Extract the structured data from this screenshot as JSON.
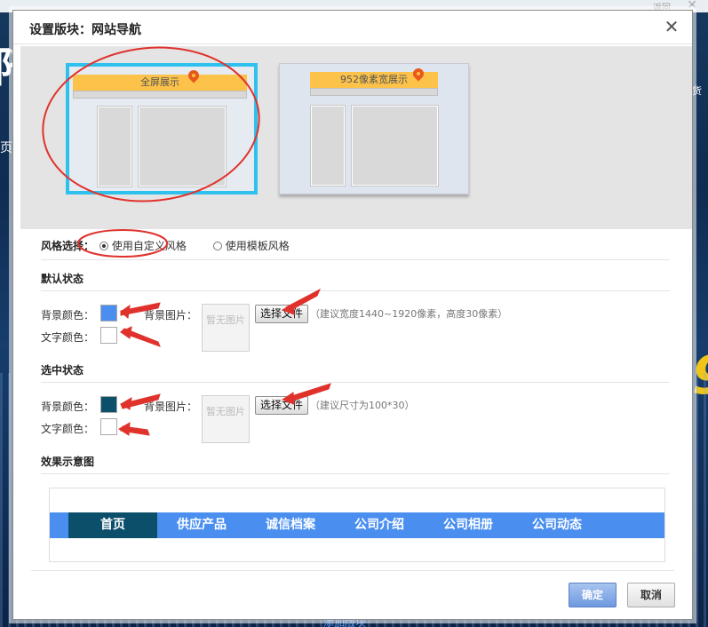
{
  "background": {
    "top_right_text": "返回",
    "big_left_text": "阡",
    "left_label": "页",
    "right_label": "货",
    "right_number": "9",
    "add_block": "添加版块"
  },
  "dialog": {
    "title": "设置版块：网站导航",
    "close_symbol": "✕",
    "layouts": [
      {
        "label": "全屏展示",
        "selected": true
      },
      {
        "label": "952像素宽展示",
        "selected": false
      }
    ],
    "style_select": {
      "label": "风格选择：",
      "options": [
        {
          "label": "使用自定义风格",
          "checked": true
        },
        {
          "label": "使用模板风格",
          "checked": false
        }
      ]
    },
    "default_state": {
      "title": "默认状态",
      "bg_color_label": "背景颜色：",
      "bg_color": "#4a8ff0",
      "text_color_label": "文字颜色：",
      "text_color": "#ffffff",
      "bg_image_label": "背景图片：",
      "no_image": "暂无图片",
      "choose_file": "选择文件",
      "hint": "（建议宽度1440~1920像素，高度30像素）"
    },
    "selected_state": {
      "title": "选中状态",
      "bg_color_label": "背景颜色：",
      "bg_color": "#0c4f6b",
      "text_color_label": "文字颜色：",
      "text_color": "#ffffff",
      "bg_image_label": "背景图片：",
      "no_image": "暂无图片",
      "choose_file": "选择文件",
      "hint": "（建议尺寸为100*30）"
    },
    "effect_preview": {
      "title": "效果示意图",
      "nav_items": [
        "首页",
        "供应产品",
        "诚信档案",
        "公司介绍",
        "公司相册",
        "公司动态"
      ],
      "active_index": 0
    },
    "buttons": {
      "ok": "确定",
      "cancel": "取消"
    }
  }
}
